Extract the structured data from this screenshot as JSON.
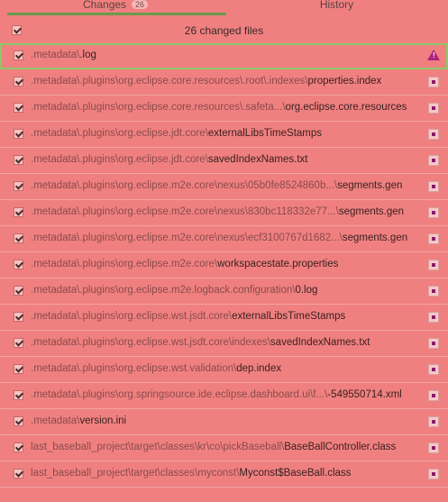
{
  "tabs": {
    "changes_label": "Changes",
    "changes_count": "26",
    "history_label": "History"
  },
  "summary": {
    "text": "26 changed files",
    "all_checked": true
  },
  "files": [
    {
      "dir": ".metadata\\",
      "name": ".log",
      "status_icon": "warning-icon",
      "checked": true,
      "selected": true
    },
    {
      "dir": ".metadata\\.plugins\\org.eclipse.core.resources\\.root\\.indexes\\",
      "name": "properties.index",
      "status_icon": "modified-icon",
      "checked": true
    },
    {
      "dir": ".metadata\\.plugins\\org.eclipse.core.resources\\.safeta...\\",
      "name": "org.eclipse.core.resources",
      "status_icon": "modified-icon",
      "checked": true
    },
    {
      "dir": ".metadata\\.plugins\\org.eclipse.jdt.core\\",
      "name": "externalLibsTimeStamps",
      "status_icon": "modified-icon",
      "checked": true
    },
    {
      "dir": ".metadata\\.plugins\\org.eclipse.jdt.core\\",
      "name": "savedIndexNames.txt",
      "status_icon": "modified-icon",
      "checked": true
    },
    {
      "dir": ".metadata\\.plugins\\org.eclipse.m2e.core\\nexus\\05b0fe8524860b...\\",
      "name": "segments.gen",
      "status_icon": "modified-icon",
      "checked": true
    },
    {
      "dir": ".metadata\\.plugins\\org.eclipse.m2e.core\\nexus\\830bc118332e77...\\",
      "name": "segments.gen",
      "status_icon": "modified-icon",
      "checked": true
    },
    {
      "dir": ".metadata\\.plugins\\org.eclipse.m2e.core\\nexus\\ecf3100767d1682...\\",
      "name": "segments.gen",
      "status_icon": "modified-icon",
      "checked": true
    },
    {
      "dir": ".metadata\\.plugins\\org.eclipse.m2e.core\\",
      "name": "workspacestate.properties",
      "status_icon": "modified-icon",
      "checked": true
    },
    {
      "dir": ".metadata\\.plugins\\org.eclipse.m2e.logback.configuration\\",
      "name": "0.log",
      "status_icon": "modified-icon",
      "checked": true
    },
    {
      "dir": ".metadata\\.plugins\\org.eclipse.wst.jsdt.core\\",
      "name": "externalLibsTimeStamps",
      "status_icon": "modified-icon",
      "checked": true
    },
    {
      "dir": ".metadata\\.plugins\\org.eclipse.wst.jsdt.core\\indexes\\",
      "name": "savedIndexNames.txt",
      "status_icon": "modified-icon",
      "checked": true
    },
    {
      "dir": ".metadata\\.plugins\\org.eclipse.wst.validation\\",
      "name": "dep.index",
      "status_icon": "modified-icon",
      "checked": true
    },
    {
      "dir": ".metadata\\.plugins\\org.springsource.ide.eclipse.dashboard.ui\\f...\\",
      "name": "-549550714.xml",
      "status_icon": "modified-icon",
      "checked": true
    },
    {
      "dir": ".metadata\\",
      "name": "version.ini",
      "status_icon": "modified-icon",
      "checked": true
    },
    {
      "dir": "last_baseball_project\\target\\classes\\kr\\co\\pickBaseball\\",
      "name": "BaseBallController.class",
      "status_icon": "modified-icon",
      "checked": true
    },
    {
      "dir": "last_baseball_project\\target\\classes\\myconst\\",
      "name": "Myconst$BaseBall.class",
      "status_icon": "modified-icon",
      "checked": true
    }
  ]
}
